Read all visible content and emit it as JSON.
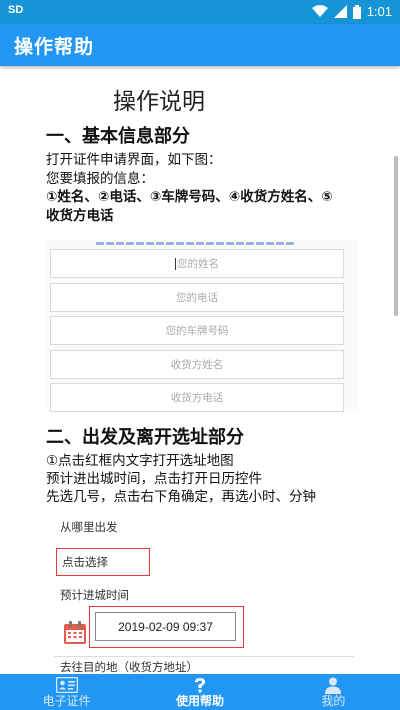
{
  "status_bar": {
    "left_icon": "SD",
    "time": "1:01",
    "icons": [
      "wifi-icon",
      "signal-icon",
      "battery-icon"
    ]
  },
  "app_bar": {
    "title": "操作帮助"
  },
  "doc": {
    "title": "操作说明",
    "section1": {
      "heading": "一、基本信息部分",
      "line1": "打开证件申请界面，如下图：",
      "line2": "您要填报的信息：",
      "line3": "①姓名、②电话、③车牌号码、④收货方姓名、⑤",
      "line4": "收货方电话",
      "fields": [
        "您的姓名",
        "您的电话",
        "您的车牌号码",
        "收货方姓名",
        "收货方电话"
      ]
    },
    "section2": {
      "heading": "二、出发及离开选址部分",
      "line1": "①点击红框内文字打开选址地图",
      "line2": "预计进出城时间，点击打开日历控件",
      "line3": "先选几号，点击右下角确定，再选小时、分钟",
      "from_label": "从哪里出发",
      "pick_text": "点击选择",
      "time_label": "预计进城时间",
      "datetime": "2019-02-09 09:37",
      "dest_label": "去往目的地（收货方地址）"
    }
  },
  "bottom_nav": [
    {
      "label": "电子证件",
      "icon": "id-card-icon",
      "active": false
    },
    {
      "label": "使用帮助",
      "icon": "help-icon",
      "active": true
    },
    {
      "label": "我的",
      "icon": "person-icon",
      "active": false
    }
  ],
  "colors": {
    "primary": "#2196f3",
    "status_bar": "#1794d6",
    "highlight_red": "#e53935"
  }
}
